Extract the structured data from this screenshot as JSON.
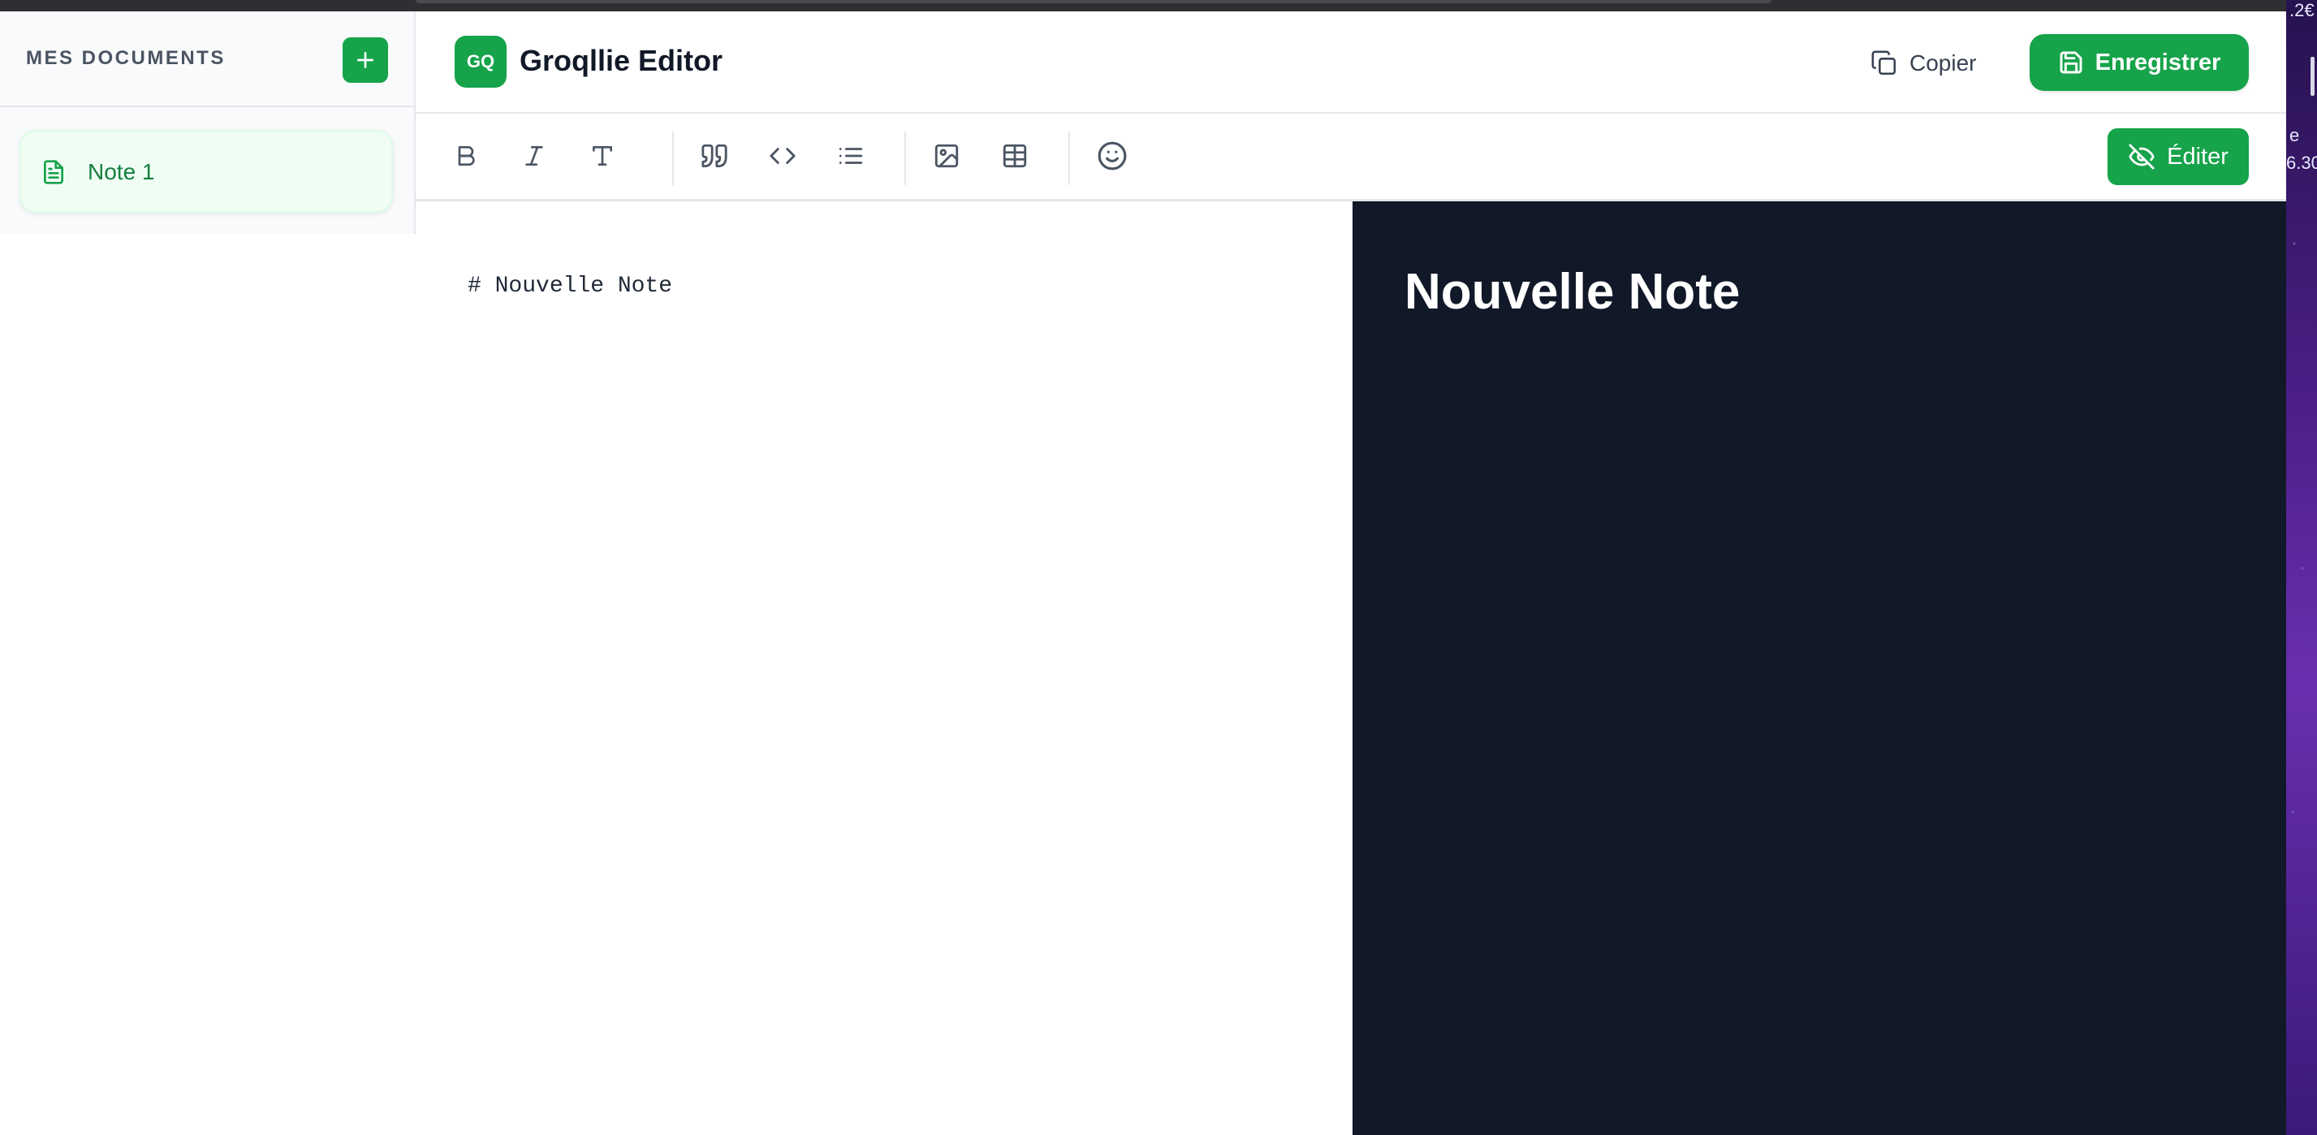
{
  "sidebar": {
    "title": "MES DOCUMENTS",
    "add_icon": "plus-icon",
    "documents": [
      {
        "label": "Note 1",
        "icon": "file-text-icon",
        "active": true
      }
    ]
  },
  "header": {
    "logo_text": "GQ",
    "title": "Groqllie Editor",
    "copy_label": "Copier",
    "copy_icon": "copy-icon",
    "save_label": "Enregistrer",
    "save_icon": "save-icon"
  },
  "toolbar": {
    "buttons": [
      {
        "name": "bold",
        "icon": "bold-icon"
      },
      {
        "name": "italic",
        "icon": "italic-icon"
      },
      {
        "name": "heading",
        "icon": "type-icon"
      },
      {
        "name": "quote",
        "icon": "quote-icon"
      },
      {
        "name": "code",
        "icon": "code-icon"
      },
      {
        "name": "list",
        "icon": "list-icon"
      },
      {
        "name": "image",
        "icon": "image-icon"
      },
      {
        "name": "table",
        "icon": "table-icon"
      },
      {
        "name": "emoji",
        "icon": "smile-icon"
      }
    ],
    "edit_label": "Éditer",
    "edit_icon": "eye-off-icon"
  },
  "editor": {
    "content": "# Nouvelle Note"
  },
  "preview": {
    "heading": "Nouvelle Note"
  },
  "desktop": {
    "text_1": ".2€",
    "text_2": "e",
    "text_3": "6.30"
  },
  "colors": {
    "accent": "#16a34a",
    "accent_light": "#f0fdf4",
    "preview_bg": "#111827"
  }
}
